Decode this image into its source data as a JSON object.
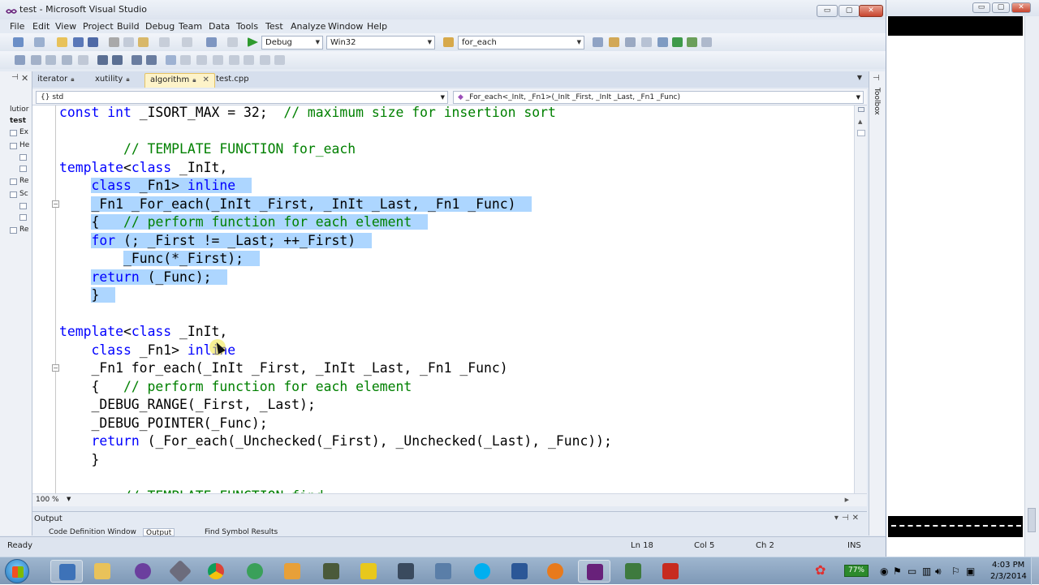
{
  "window": {
    "title": "test - Microsoft Visual Studio",
    "min_label": "▭",
    "max_label": "▢",
    "close_label": "✕"
  },
  "menu": [
    "File",
    "Edit",
    "View",
    "Project",
    "Build",
    "Debug",
    "Team",
    "Data",
    "Tools",
    "Test",
    "Analyze",
    "Window",
    "Help"
  ],
  "toolbar": {
    "config": "Debug",
    "platform": "Win32",
    "find": "for_each"
  },
  "solution_strip": {
    "items": [
      "lutior",
      "test",
      "Ex",
      "He",
      "Re",
      "Sc",
      "Re"
    ]
  },
  "tabs": [
    {
      "label": "iterator"
    },
    {
      "label": "xutility"
    },
    {
      "label": "algorithm"
    },
    {
      "label": "test.cpp"
    }
  ],
  "navbar": {
    "scope": "{} std",
    "member": "_For_each<_InIt, _Fn1>(_InIt _First, _InIt _Last, _Fn1 _Func)"
  },
  "code": [
    {
      "parts": [
        [
          "kw",
          "const"
        ],
        [
          "",
          " "
        ],
        [
          "kw",
          "int"
        ],
        [
          "",
          " _ISORT_MAX = 32;  "
        ],
        [
          "cm",
          "// maximum size for insertion sort"
        ]
      ]
    },
    {
      "parts": []
    },
    {
      "parts": [
        [
          "",
          "        "
        ],
        [
          "cm",
          "// TEMPLATE FUNCTION for_each"
        ]
      ]
    },
    {
      "parts": [
        [
          "kw",
          "template"
        ],
        [
          "",
          "<"
        ],
        [
          "kw",
          "class"
        ],
        [
          "",
          " _InIt,"
        ]
      ]
    },
    {
      "parts": [
        [
          "",
          "    "
        ],
        [
          "kw",
          "class"
        ],
        [
          "",
          " _Fn1> "
        ],
        [
          "kw",
          "inline"
        ]
      ]
    },
    {
      "parts": [
        [
          "",
          "    _Fn1 _For_each(_InIt _First, _InIt _Last, _Fn1 _Func)"
        ]
      ]
    },
    {
      "parts": [
        [
          "",
          "    {   "
        ],
        [
          "cm",
          "// perform function for each element"
        ]
      ]
    },
    {
      "parts": [
        [
          "",
          "    "
        ],
        [
          "kw",
          "for"
        ],
        [
          "",
          " (; _First != _Last; ++_First)"
        ]
      ]
    },
    {
      "parts": [
        [
          "",
          "        _Func(*_First);"
        ]
      ]
    },
    {
      "parts": [
        [
          "",
          "    "
        ],
        [
          "kw",
          "return"
        ],
        [
          "",
          " (_Func);"
        ]
      ]
    },
    {
      "parts": [
        [
          "",
          "    }"
        ]
      ]
    },
    {
      "parts": []
    },
    {
      "parts": [
        [
          "kw",
          "template"
        ],
        [
          "",
          "<"
        ],
        [
          "kw",
          "class"
        ],
        [
          "",
          " _InIt,"
        ]
      ]
    },
    {
      "parts": [
        [
          "",
          "    "
        ],
        [
          "kw",
          "class"
        ],
        [
          "",
          " _Fn1> "
        ],
        [
          "kw",
          "inline"
        ]
      ]
    },
    {
      "parts": [
        [
          "",
          "    _Fn1 for_each(_InIt _First, _InIt _Last, _Fn1 _Func)"
        ]
      ]
    },
    {
      "parts": [
        [
          "",
          "    {   "
        ],
        [
          "cm",
          "// perform function for each element"
        ]
      ]
    },
    {
      "parts": [
        [
          "",
          "    _DEBUG_RANGE(_First, _Last);"
        ]
      ]
    },
    {
      "parts": [
        [
          "",
          "    _DEBUG_POINTER(_Func);"
        ]
      ]
    },
    {
      "parts": [
        [
          "",
          "    "
        ],
        [
          "kw",
          "return"
        ],
        [
          "",
          " (_For_each(_Unchecked(_First), _Unchecked(_Last), _Func));"
        ]
      ]
    },
    {
      "parts": [
        [
          "",
          "    }"
        ]
      ]
    },
    {
      "parts": []
    },
    {
      "parts": [
        [
          "",
          "        "
        ],
        [
          "cm",
          "// TEMPLATE FUNCTION find"
        ]
      ]
    }
  ],
  "zoom": "100 %",
  "toolbox_label": "Toolbox",
  "output": {
    "title": "Output",
    "tabs": [
      "Code Definition Window",
      "Output",
      "Find Symbol Results"
    ]
  },
  "status": {
    "state": "Ready",
    "line": "Ln 18",
    "col": "Col 5",
    "ch": "Ch 2",
    "mode": "INS"
  },
  "tray": {
    "battery": "77%",
    "time": "4:03 PM",
    "date": "2/3/2014"
  },
  "colors": {
    "keyword": "#0000ff",
    "comment": "#008000",
    "selection": "#add6ff",
    "active_tab": "#fdf3c9"
  }
}
